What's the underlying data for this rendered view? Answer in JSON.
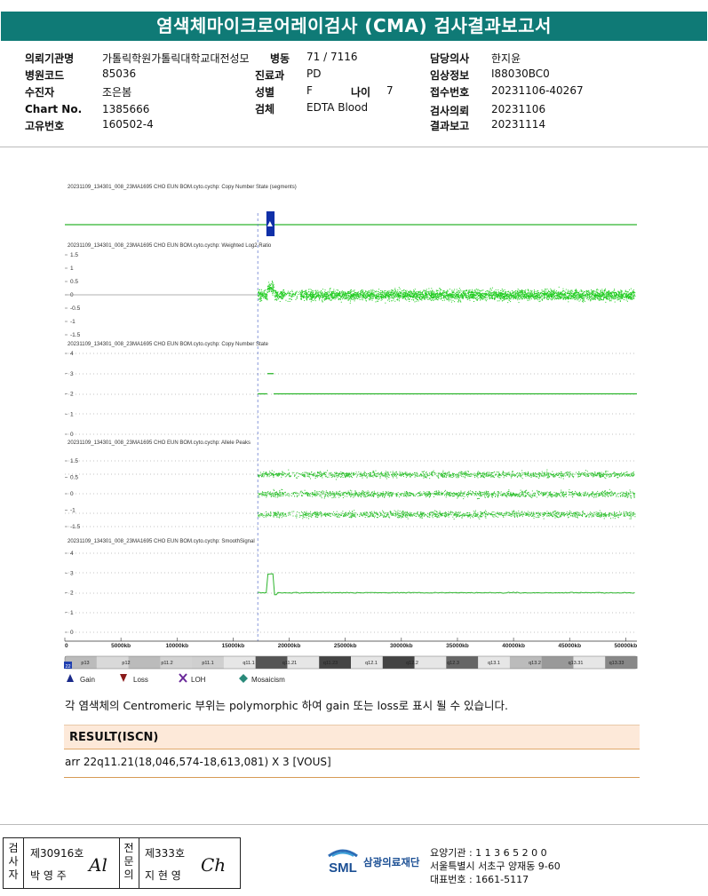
{
  "report": {
    "title": "염색체마이크로어레이검사 (CMA) 검사결과보고서"
  },
  "info": {
    "institution_label": "의뢰기관명",
    "institution": "가톨릭학원가톨릭대학교대전성모",
    "ward_label": "병동",
    "ward": "71 / 7116",
    "doctor_label": "담당의사",
    "doctor": "한지윤",
    "hospital_code_label": "병원코드",
    "hospital_code": "85036",
    "dept_label": "진료과",
    "dept": "PD",
    "clinical_label": "임상정보",
    "clinical": "I88030BC0",
    "patient_label": "수진자",
    "patient": "조은봄",
    "sex_label": "성별",
    "sex": "F",
    "age_label": "나이",
    "age": "7",
    "receipt_label": "접수번호",
    "receipt": "20231106-40267",
    "chart_label": "Chart No.",
    "chart": "1385666",
    "specimen_label": "검체",
    "specimen": "EDTA Blood",
    "request_label": "검사의뢰",
    "request": "20231106",
    "uid_label": "고유번호",
    "uid": "160502-4",
    "report_date_label": "결과보고",
    "report_date": "20231114"
  },
  "chart_data": [
    {
      "type": "line",
      "title": "20231109_134301_008_23MA1695 CHO EUN BOM.cyto.cychp: Copy Number State (segments)",
      "x_range_kb": [
        0,
        51000
      ],
      "markers": [
        {
          "type": "Gain",
          "start_kb": 18046,
          "end_kb": 18613
        }
      ]
    },
    {
      "type": "scatter",
      "title": "20231109_134301_008_23MA1695 CHO EUN BOM.cyto.cychp: Weighted Log2 Ratio",
      "ylim": [
        -1.5,
        1.5
      ],
      "yticks": [
        "1.5",
        "1",
        "0.5",
        "0",
        "-0.5",
        "-1",
        "-1.5"
      ],
      "baseline": 0
    },
    {
      "type": "line",
      "title": "20231109_134301_008_23MA1695 CHO EUN BOM.cyto.cychp: Copy Number State",
      "ylim": [
        0,
        4
      ],
      "yticks": [
        "4",
        "3",
        "2",
        "1",
        "0"
      ],
      "segments": [
        {
          "start_kb": 17200,
          "end_kb": 18046,
          "value": 2
        },
        {
          "start_kb": 18046,
          "end_kb": 18613,
          "value": 3
        },
        {
          "start_kb": 18613,
          "end_kb": 51000,
          "value": 2
        }
      ]
    },
    {
      "type": "scatter",
      "title": "20231109_134301_008_23MA1695 CHO EUN BOM.cyto.cychp: Allele Peaks",
      "ylim": [
        -1.5,
        1.5
      ],
      "yticks": [
        "1.5",
        "0.5",
        "0",
        "-1",
        "-1.5"
      ],
      "bands": [
        1,
        0,
        -1
      ]
    },
    {
      "type": "line",
      "title": "20231109_134301_008_23MA1695 CHO EUN BOM.cyto.cychp: SmoothSignal",
      "ylim": [
        0,
        4
      ],
      "yticks": [
        "4",
        "3",
        "2",
        "1",
        "0"
      ],
      "baseline": 2,
      "peak": {
        "start_kb": 18046,
        "end_kb": 18613,
        "value": 3
      }
    }
  ],
  "axis": {
    "labels": [
      "0",
      "5000kb",
      "10000kb",
      "15000kb",
      "20000kb",
      "25000kb",
      "30000kb",
      "35000kb",
      "40000kb",
      "45000kb",
      "50000kb"
    ]
  },
  "ideogram": {
    "chromosome": "22",
    "bands": [
      "p13",
      "p12",
      "p11.2",
      "p11.1",
      "q11.1",
      "q11.21",
      "q11.23",
      "q12.1",
      "q12.2",
      "q12.3",
      "q13.1",
      "q13.2",
      "q13.31",
      "q13.33"
    ],
    "colors": [
      "#bbbbbb",
      "#d9d9d9",
      "#bbbbbb",
      "#d2d2d2",
      "#cfcfcf",
      "#e6e6e6",
      "#555555",
      "#e6e6e6",
      "#444444",
      "#e6e6e6",
      "#444444",
      "#e6e6e6",
      "#666666",
      "#e6e6e6",
      "#bbbbbb",
      "#999999",
      "#e6e6e6",
      "#888888"
    ]
  },
  "legend": {
    "gain": "Gain",
    "loss": "Loss",
    "loh": "LOH",
    "mosaicism": "Mosaicism"
  },
  "note": "각 염색체의 Centromeric 부위는 polymorphic 하여 gain 또는 loss로 표시 될 수 있습니다.",
  "result": {
    "header": "RESULT(ISCN)",
    "value": "arr 22q11.21(18,046,574-18,613,081) X 3 [VOUS]"
  },
  "signature": {
    "examiner_label": "검사자",
    "examiner_no": "제30916호",
    "examiner_name": "박 영 주",
    "examiner_sign": "Al",
    "reviewer_label": "전문의",
    "reviewer_no": "제333호",
    "reviewer_name": "지 현 영",
    "reviewer_sign": "Ch"
  },
  "lab": {
    "logo": "SML",
    "name": "삼광의료재단",
    "code": "요양기관 : 1 1 3 6 5 2 0 0",
    "address": "서울특별시 서초구 양재동 9-60",
    "phone": "대표번호 : 1661-5117"
  }
}
